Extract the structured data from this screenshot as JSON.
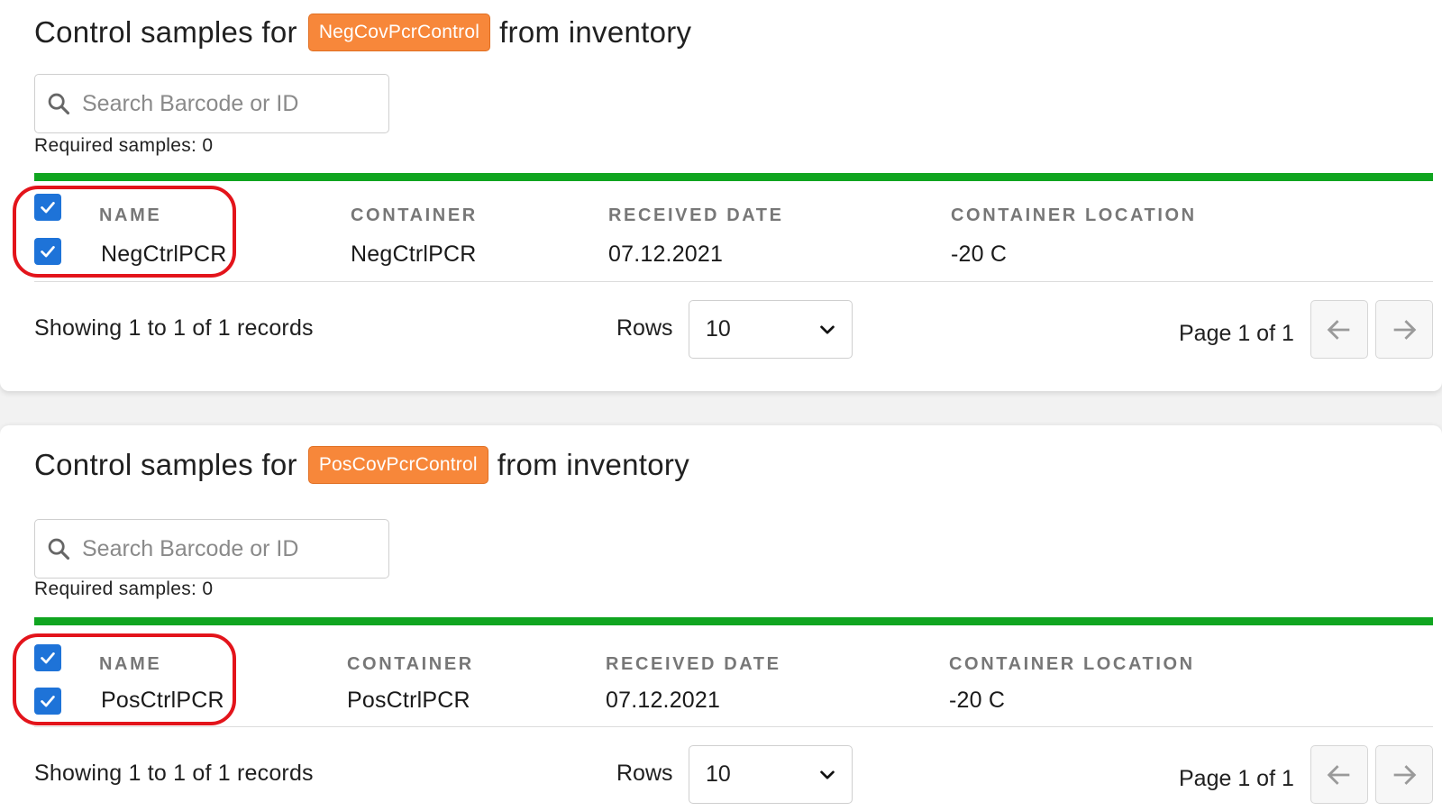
{
  "panels": [
    {
      "title_prefix": "Control samples for",
      "tag": "NegCovPcrControl",
      "title_suffix": "from inventory",
      "search": {
        "placeholder": "Search Barcode or ID",
        "value": ""
      },
      "required_samples": "Required samples: 0",
      "columns": [
        "NAME",
        "CONTAINER",
        "RECEIVED DATE",
        "CONTAINER LOCATION"
      ],
      "rows": [
        {
          "checked": true,
          "name": "NegCtrlPCR",
          "container": "NegCtrlPCR",
          "received_date": "07.12.2021",
          "container_location": "-20 C"
        }
      ],
      "showing": "Showing 1 to 1 of 1 records",
      "rows_label": "Rows",
      "rows_value": "10",
      "page_info": "Page 1 of 1"
    },
    {
      "title_prefix": "Control samples for",
      "tag": "PosCovPcrControl",
      "title_suffix": "from inventory",
      "search": {
        "placeholder": "Search Barcode or ID",
        "value": ""
      },
      "required_samples": "Required samples: 0",
      "columns": [
        "NAME",
        "CONTAINER",
        "RECEIVED DATE",
        "CONTAINER LOCATION"
      ],
      "rows": [
        {
          "checked": true,
          "name": "PosCtrlPCR",
          "container": "PosCtrlPCR",
          "received_date": "07.12.2021",
          "container_location": "-20 C"
        }
      ],
      "showing": "Showing 1 to 1 of 1 records",
      "rows_label": "Rows",
      "rows_value": "10",
      "page_info": "Page 1 of 1"
    }
  ],
  "colors": {
    "tag": "#f7873a",
    "progress_bar": "#10a520",
    "checkbox": "#1e73d8",
    "highlight": "#e3141b"
  },
  "icons": {
    "search": "search-icon",
    "checkbox": "checkbox-checked-icon",
    "dropdown": "chevron-down-icon",
    "prev": "arrow-left-icon",
    "next": "arrow-right-icon"
  }
}
